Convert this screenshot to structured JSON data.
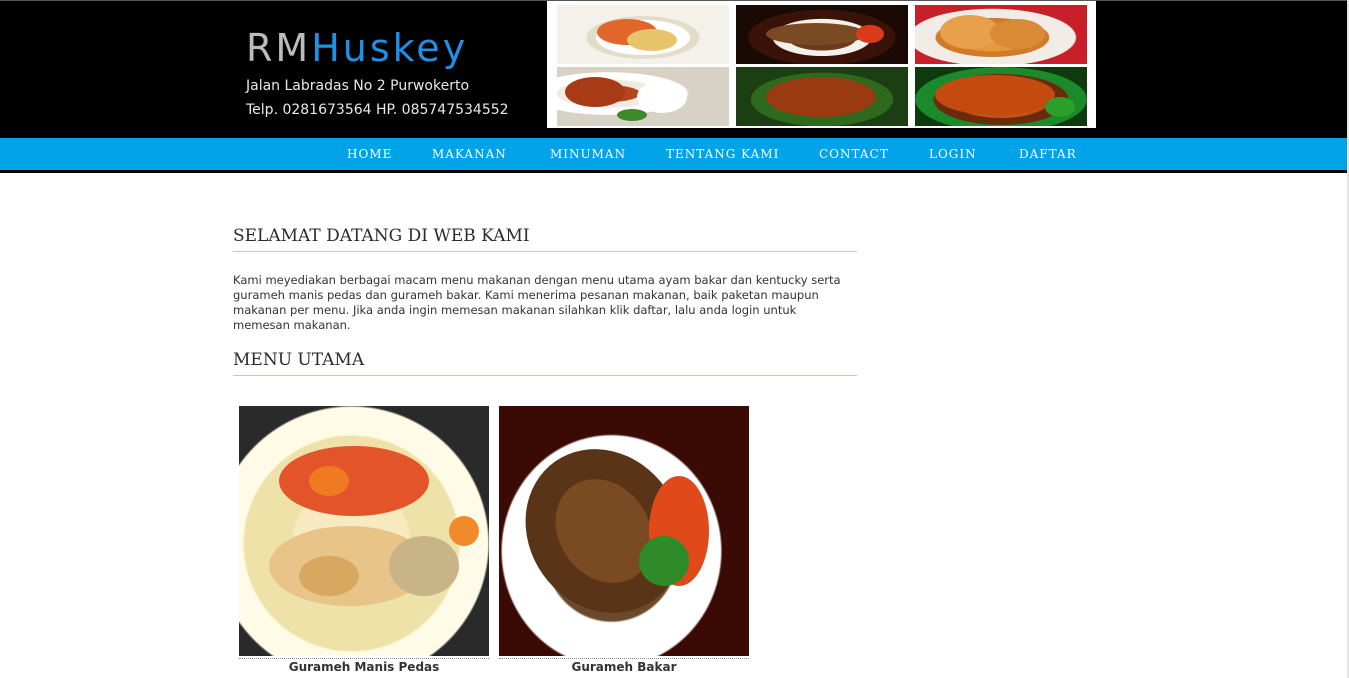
{
  "header": {
    "brand_prefix": "RM",
    "brand_name": "Huskey",
    "address": "Jalan Labradas No 2 Purwokerto",
    "phone": "Telp. 0281673564 HP. 085747534552",
    "banner_photos": [
      "food-photo",
      "food-photo",
      "food-photo",
      "food-photo",
      "food-photo",
      "food-photo"
    ]
  },
  "nav": {
    "items": [
      {
        "label": "HOME"
      },
      {
        "label": "MAKANAN"
      },
      {
        "label": "MINUMAN"
      },
      {
        "label": "TENTANG KAMI"
      },
      {
        "label": "CONTACT"
      },
      {
        "label": "LOGIN"
      },
      {
        "label": "DAFTAR"
      }
    ]
  },
  "main": {
    "welcome_title": "SELAMAT DATANG DI WEB KAMI",
    "intro_text": "Kami meyediakan berbagai macam menu makanan dengan menu utama ayam bakar dan kentucky serta gurameh manis pedas dan gurameh bakar. Kami menerima pesanan makanan, baik paketan maupun makanan per menu. Jika anda ingin memesan makanan silahkan klik daftar, lalu anda login untuk memesan makanan.",
    "menu_title": "MENU UTAMA",
    "menu_items": [
      {
        "name": "Gurameh Manis Pedas"
      },
      {
        "name": "Gurameh Bakar"
      }
    ]
  },
  "colors": {
    "header_bg": "#000000",
    "nav_bg": "#00a3e8",
    "brand_accent": "#1e90e6",
    "brand_muted": "#bcbcbc"
  }
}
